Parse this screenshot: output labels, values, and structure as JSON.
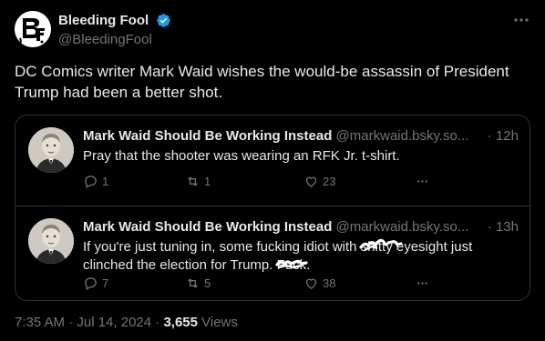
{
  "author": {
    "display_name": "Bleeding Fool",
    "handle": "@BleedingFool",
    "logo_text": "BF"
  },
  "tweet": {
    "text": "DC Comics writer Mark Waid wishes the would-be assassin of President Trump had been a better shot."
  },
  "quoted": [
    {
      "name": "Mark Waid Should Be Working Instead",
      "handle": "@markwaid.bsky.so...",
      "time": "· 12h",
      "text": "Pray that the shooter was wearing an RFK Jr. t-shirt.",
      "replies": "1",
      "reposts": "1",
      "likes": "23"
    },
    {
      "name": "Mark Waid Should Be Working Instead",
      "handle": "@markwaid.bsky.so...",
      "time": "· 13h",
      "text_a": "If you're just tuning in, some fucking idiot with ",
      "text_redacted1": "shitty",
      "text_b": " eyesight just clinched the election for Trump. ",
      "text_redacted2": "Fuck",
      "text_c": ".",
      "replies": "7",
      "reposts": "5",
      "likes": "38"
    }
  ],
  "footer": {
    "timestamp": "7:35 AM · Jul 14, 2024 · ",
    "views_count": "3,655",
    "views_label": " Views"
  },
  "colors": {
    "background": "#000000",
    "text": "#e7e9ea",
    "muted": "#71767b",
    "border": "#2f3336",
    "verified": "#1d9bf0"
  }
}
